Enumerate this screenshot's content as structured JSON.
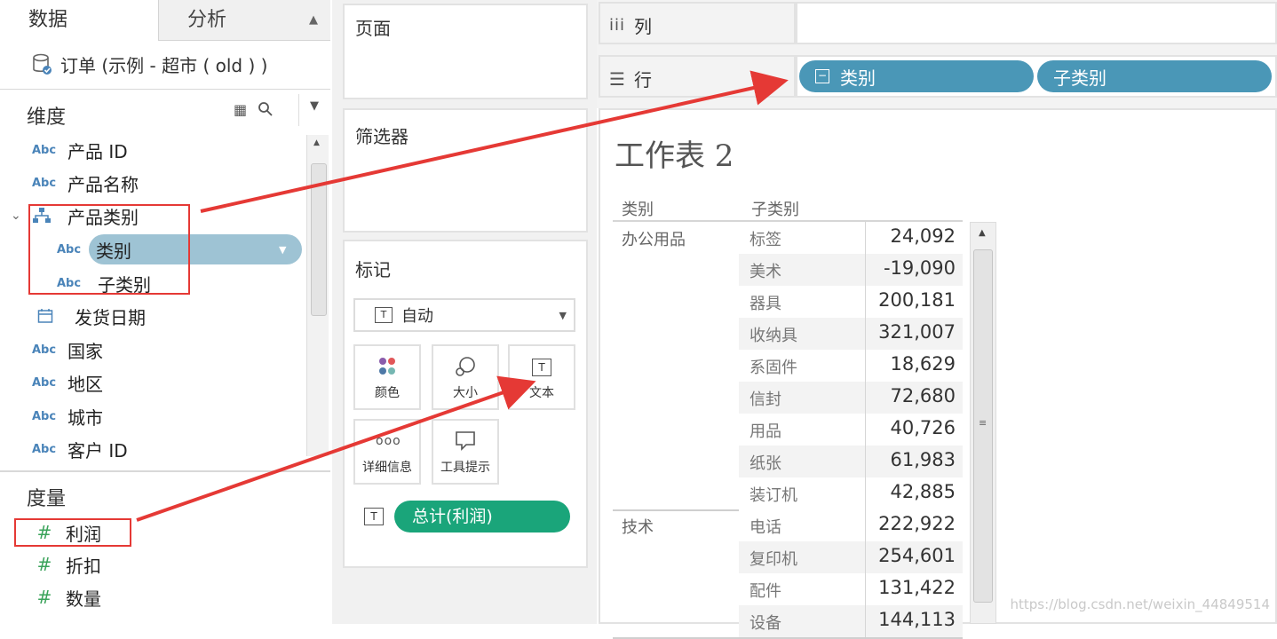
{
  "tabs": {
    "data": "数据",
    "analysis": "分析"
  },
  "datasource": "订单 (示例 - 超市 ( old ) )",
  "dimensions": {
    "title": "维度",
    "fields": [
      {
        "type": "Abc",
        "name": "产品 ID"
      },
      {
        "type": "Abc",
        "name": "产品名称"
      },
      {
        "type": "hierarchy",
        "name": "产品类别"
      },
      {
        "type": "Abc",
        "name": "类别"
      },
      {
        "type": "Abc",
        "name": "子类别"
      },
      {
        "type": "date",
        "name": "发货日期"
      },
      {
        "type": "Abc",
        "name": "国家"
      },
      {
        "type": "Abc",
        "name": "地区"
      },
      {
        "type": "Abc",
        "name": "城市"
      },
      {
        "type": "Abc",
        "name": "客户 ID"
      }
    ]
  },
  "measures": {
    "title": "度量",
    "fields": [
      {
        "type": "#",
        "name": "利润"
      },
      {
        "type": "#",
        "name": "折扣"
      },
      {
        "type": "#",
        "name": "数量"
      }
    ]
  },
  "icons": {
    "abc": "Abc",
    "hash": "#"
  },
  "cards": {
    "pages": "页面",
    "filters": "筛选器",
    "marks": {
      "title": "标记",
      "type_select": "自动",
      "buttons": {
        "color": "颜色",
        "size": "大小",
        "text": "文本",
        "detail": "详细信息",
        "tooltip": "工具提示"
      },
      "text_pill": "总计(利润)"
    }
  },
  "shelves": {
    "columns_label": "列",
    "rows_label": "行",
    "rows_pills": [
      "类别",
      "子类别"
    ]
  },
  "sheet": {
    "title": "工作表 2",
    "headers": {
      "category": "类别",
      "subcategory": "子类别"
    },
    "groups": [
      {
        "category": "办公用品",
        "rows": [
          {
            "sub": "标签",
            "value": "24,092"
          },
          {
            "sub": "美术",
            "value": "-19,090"
          },
          {
            "sub": "器具",
            "value": "200,181"
          },
          {
            "sub": "收纳具",
            "value": "321,007"
          },
          {
            "sub": "系固件",
            "value": "18,629"
          },
          {
            "sub": "信封",
            "value": "72,680"
          },
          {
            "sub": "用品",
            "value": "40,726"
          },
          {
            "sub": "纸张",
            "value": "61,983"
          },
          {
            "sub": "装订机",
            "value": "42,885"
          }
        ]
      },
      {
        "category": "技术",
        "rows": [
          {
            "sub": "电话",
            "value": "222,922"
          },
          {
            "sub": "复印机",
            "value": "254,601"
          },
          {
            "sub": "配件",
            "value": "131,422"
          },
          {
            "sub": "设备",
            "value": "144,113"
          }
        ]
      }
    ]
  },
  "colors": {
    "pill_blue": "#4a97b7",
    "pill_green": "#1aa57a",
    "annotation_red": "#e53935"
  },
  "watermark": "https://blog.csdn.net/weixin_44849514"
}
